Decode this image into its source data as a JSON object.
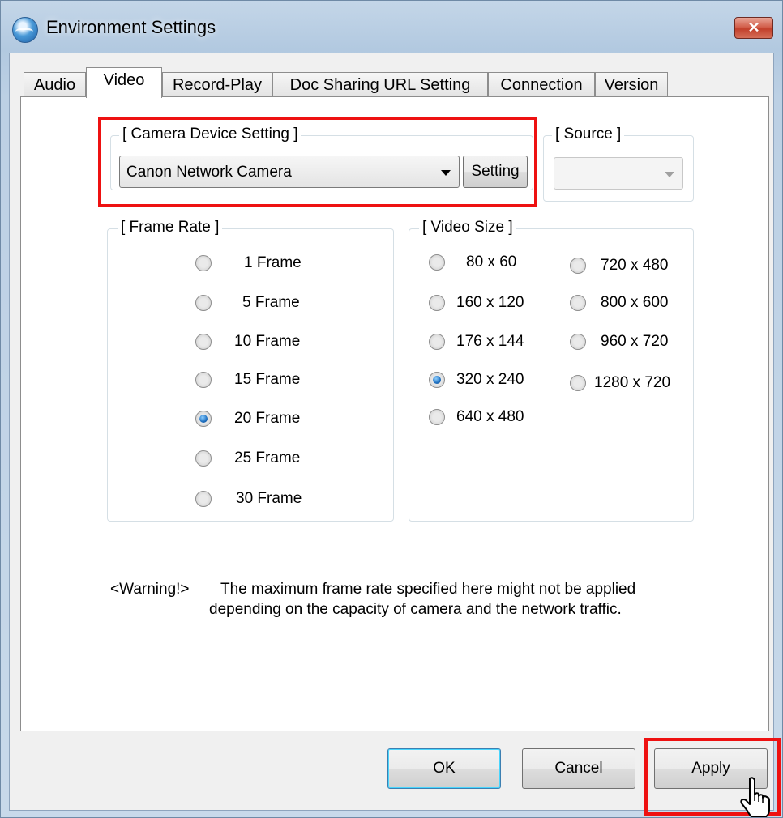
{
  "window": {
    "title": "Environment Settings",
    "close_glyph": "✕"
  },
  "tabs": [
    {
      "label": "Audio",
      "active": false
    },
    {
      "label": "Video",
      "active": true
    },
    {
      "label": "Record-Play",
      "active": false
    },
    {
      "label": "Doc Sharing URL Setting",
      "active": false
    },
    {
      "label": "Connection",
      "active": false
    },
    {
      "label": "Version",
      "active": false
    }
  ],
  "camera": {
    "group_label": "[ Camera Device Setting ]",
    "device_value": "Canon Network Camera",
    "setting_button": "Setting"
  },
  "source": {
    "group_label": "[ Source ]",
    "value": ""
  },
  "frame_rate": {
    "group_label": "[ Frame Rate ]",
    "options": [
      "1 Frame",
      "5 Frame",
      "10 Frame",
      "15 Frame",
      "20 Frame",
      "25 Frame",
      "30 Frame"
    ],
    "selected": "20 Frame"
  },
  "video_size": {
    "group_label": "[ Video Size ]",
    "options_left": [
      "80 x 60",
      "160 x 120",
      "176 x 144",
      "320 x 240",
      "640 x 480"
    ],
    "options_right": [
      "720 x 480",
      "800 x 600",
      "960 x 720",
      "1280 x 720"
    ],
    "selected": "320 x 240"
  },
  "warning": {
    "prefix": "<Warning!>",
    "line1": "The maximum frame rate specified here might not be applied",
    "line2": "depending on the capacity of camera and the network traffic."
  },
  "footer": {
    "ok": "OK",
    "cancel": "Cancel",
    "apply": "Apply"
  },
  "colors": {
    "highlight": "#ee1111",
    "accent": "#1e6fc0"
  },
  "icons": {
    "app": "globe-icon",
    "close": "close-icon",
    "cursor": "hand-pointer-icon"
  }
}
